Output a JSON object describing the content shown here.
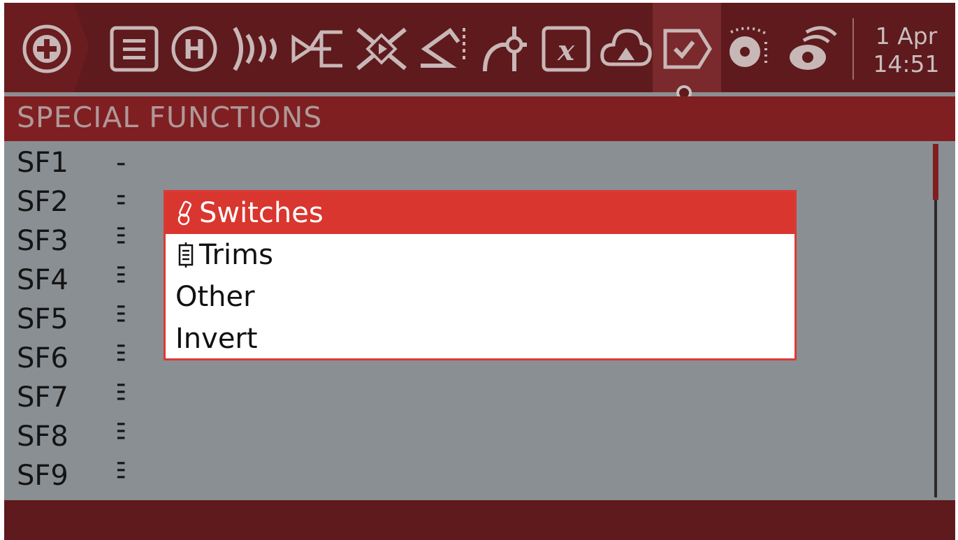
{
  "topbar": {
    "icons": [
      "plus-icon",
      "menu-icon",
      "heli-icon",
      "sound-waves-icon",
      "mixer-icon",
      "cross-icon",
      "curve-icon",
      "logic-icon",
      "x-function-icon",
      "cloud-icon",
      "check-icon",
      "telemetry-icon",
      "radar-icon"
    ],
    "date": "1 Apr",
    "time": "14:51"
  },
  "page": {
    "title": "SPECIAL FUNCTIONS"
  },
  "rows": [
    {
      "label": "SF1",
      "value": "---"
    },
    {
      "label": "SF2",
      "value": "---"
    },
    {
      "label": "SF3",
      "value": "---"
    },
    {
      "label": "SF4",
      "value": "---"
    },
    {
      "label": "SF5",
      "value": "---"
    },
    {
      "label": "SF6",
      "value": "---"
    },
    {
      "label": "SF7",
      "value": "---"
    },
    {
      "label": "SF8",
      "value": "---"
    },
    {
      "label": "SF9",
      "value": "---"
    }
  ],
  "popup": {
    "items": [
      {
        "label": "Switches",
        "icon": "switch-icon",
        "selected": true
      },
      {
        "label": "Trims",
        "icon": "trim-icon",
        "selected": false
      },
      {
        "label": "Other",
        "icon": "",
        "selected": false
      },
      {
        "label": "Invert",
        "icon": "",
        "selected": false
      }
    ]
  },
  "colors": {
    "accent": "#d9362f",
    "bar": "#5e1a1d",
    "title_band": "#7f1f22",
    "background": "#8a8f93"
  }
}
